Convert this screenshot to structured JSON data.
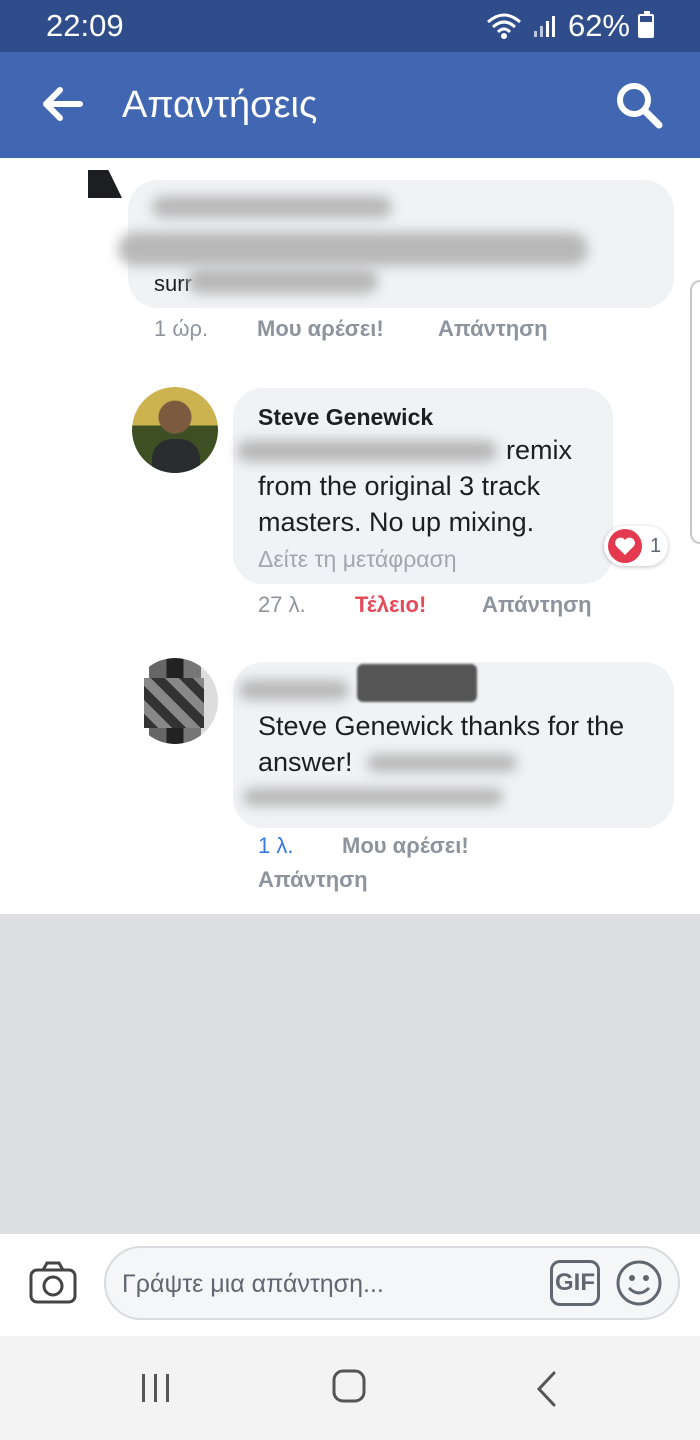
{
  "status_bar": {
    "time": "22:09",
    "battery": "62%"
  },
  "app_bar": {
    "title": "Απαντήσεις"
  },
  "comments": [
    {
      "author": "",
      "text_visible": "surr",
      "meta": {
        "time": "1 ώρ.",
        "like": "Μου αρέσει!",
        "reply": "Απάντηση"
      }
    },
    {
      "author": "Steve Genewick",
      "lines": [
        "remix",
        "from the original 3 track",
        "masters. No up mixing."
      ],
      "translate": "Δείτε τη μετάφραση",
      "reaction_count": "1",
      "meta": {
        "time": "27 λ.",
        "like": "Τέλειο!",
        "reply": "Απάντηση"
      }
    },
    {
      "author": "",
      "lines": [
        "Steve Genewick thanks for the",
        "answer!"
      ],
      "meta": {
        "time": "1 λ.",
        "like": "Μου αρέσει!",
        "reply": "Απάντηση"
      }
    }
  ],
  "composer": {
    "placeholder": "Γράψτε μια απάντηση...",
    "gif_label": "GIF"
  },
  "icons": {
    "back": "back-arrow-icon",
    "search": "search-icon",
    "camera": "camera-icon",
    "emoji": "emoji-icon",
    "heart": "heart-icon",
    "nav": [
      "recent-apps-icon",
      "home-icon",
      "back-icon"
    ]
  },
  "colors": {
    "header": "#4267b2",
    "status_bar": "#2f4d8a",
    "like_red": "#e44b5b",
    "time_blue": "#3578e5"
  }
}
